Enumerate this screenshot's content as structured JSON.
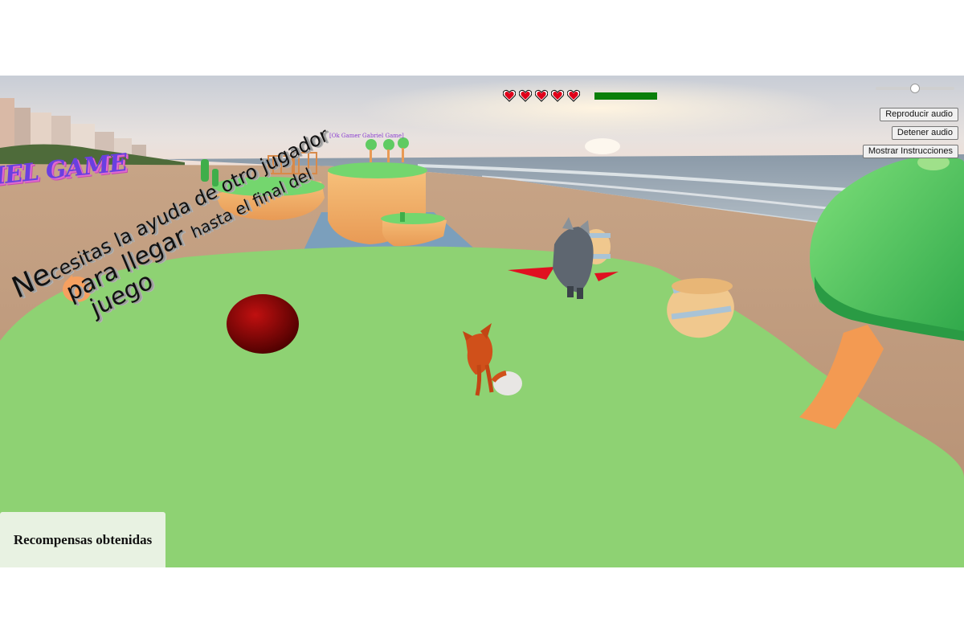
{
  "hud": {
    "hearts": [
      {
        "icon": "heart-icon",
        "filled": true
      },
      {
        "icon": "heart-icon",
        "filled": true
      },
      {
        "icon": "heart-icon",
        "filled": true
      },
      {
        "icon": "heart-icon",
        "filled": true
      },
      {
        "icon": "heart-icon",
        "filled": true
      }
    ],
    "health_fraction": 1.0,
    "health_color": "#0a7f0a",
    "heart_color": "#e0001a"
  },
  "volume": {
    "level": 0.5
  },
  "buttons": {
    "play_audio": "Reproducir audio",
    "stop_audio": "Detener audio",
    "show_instructions": "Mostrar Instrucciones"
  },
  "instruction": {
    "line1_big": "Ne",
    "line1_rest": "cesitas la ayuda de otro jugador",
    "line2": "para llegar ",
    "line2_small": "hasta el final del",
    "line3": "juego"
  },
  "title_fragment": "IEL GAME",
  "floating_name": "[Ok Gamer Gabriel Game]",
  "rewards": {
    "label": "Recompensas obtenidas"
  },
  "colors": {
    "grass": "#8ed273",
    "sky": "#dfe3e8",
    "sand": "#c9a68a",
    "sea": "#7a8a97"
  }
}
